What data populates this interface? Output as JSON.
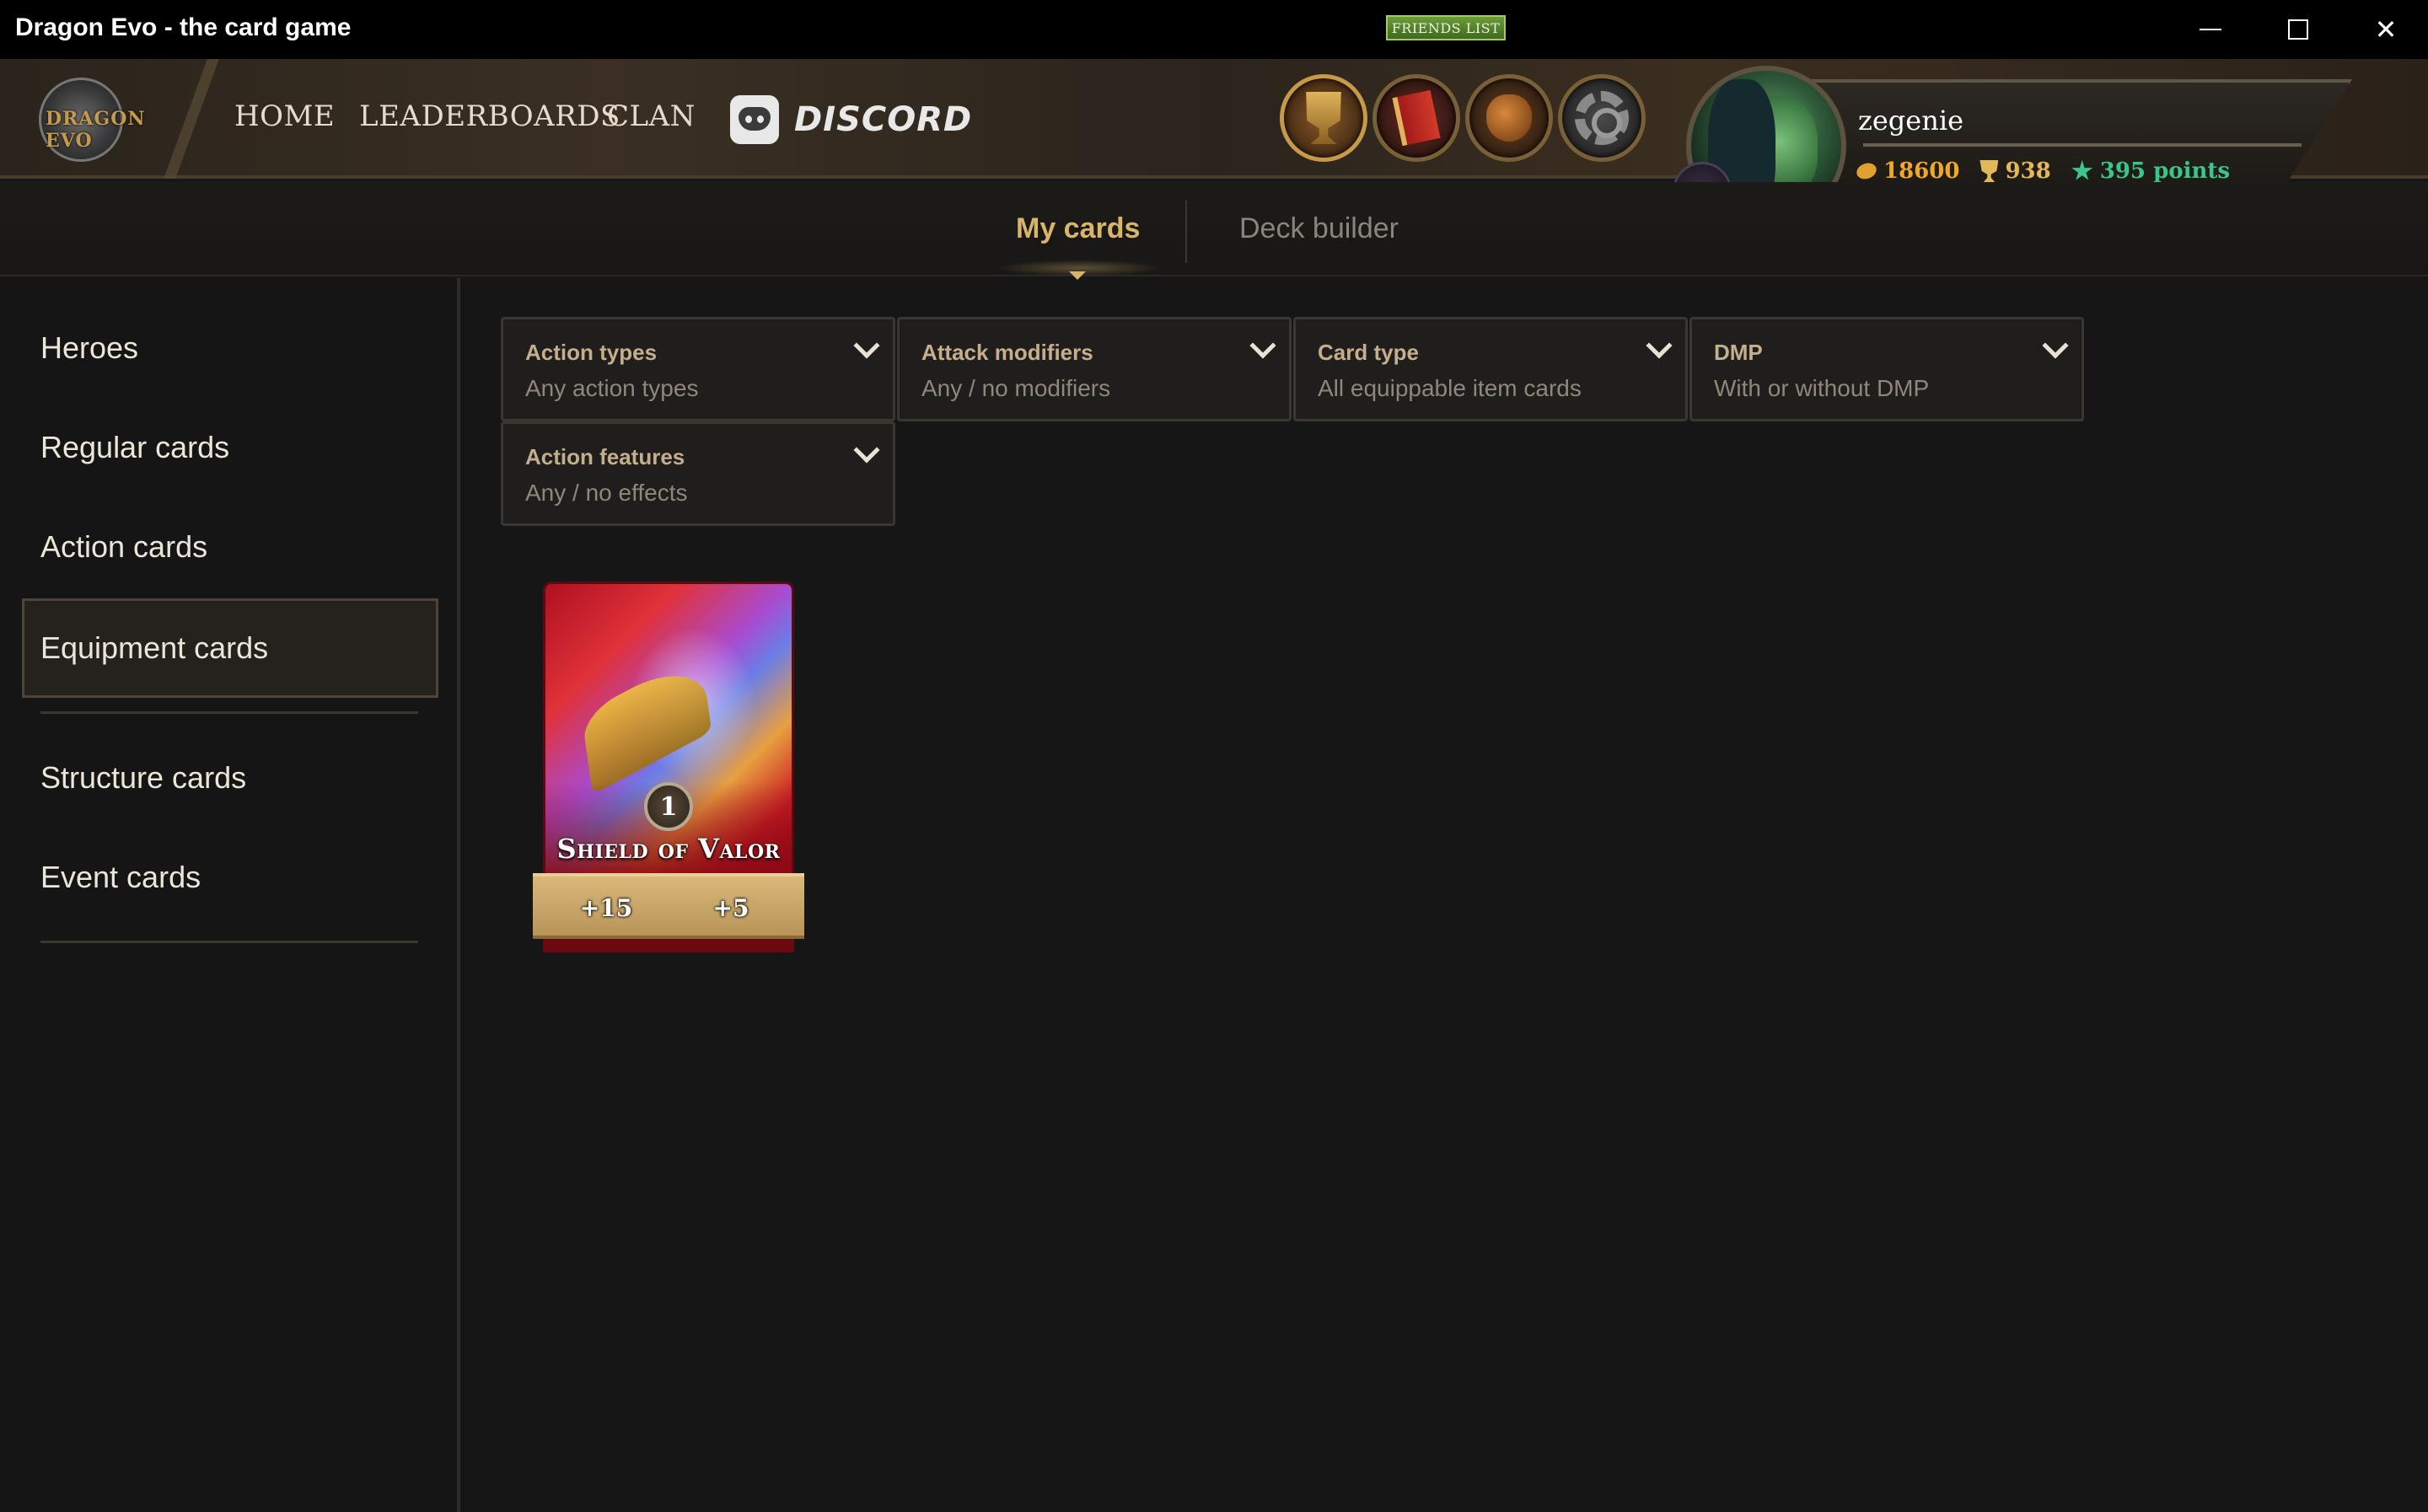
{
  "window": {
    "title": "Dragon Evo - the card game",
    "controls": {
      "minimize": "",
      "maximize": "",
      "close": "✕"
    }
  },
  "header": {
    "logo_text": "DRAGON EVO",
    "nav": [
      {
        "label": "HOME"
      },
      {
        "label": "LEADERBOARDS"
      },
      {
        "label": "CLAN"
      }
    ],
    "discord_label": "DISCORD",
    "icon_buttons": [
      "trophy-icon",
      "book-icon",
      "bag-icon",
      "gear-icon"
    ]
  },
  "profile": {
    "username": "zegenie",
    "gold": "18600",
    "trophies": "938",
    "points": "395 points",
    "friends_label": "FRIENDS LIST"
  },
  "tabs": {
    "my_cards": "My cards",
    "deck_builder": "Deck builder",
    "active": "my_cards"
  },
  "sidebar": {
    "items": [
      {
        "label": "Heroes"
      },
      {
        "label": "Regular cards"
      },
      {
        "label": "Action cards"
      },
      {
        "label": "Equipment cards",
        "selected": true
      },
      {
        "label": "Structure cards"
      },
      {
        "label": "Event cards"
      }
    ]
  },
  "filters": [
    {
      "label": "Action types",
      "value": "Any action types"
    },
    {
      "label": "Attack modifiers",
      "value": "Any / no modifiers"
    },
    {
      "label": "Card type",
      "value": "All equippable item cards"
    },
    {
      "label": "DMP",
      "value": "With or without DMP"
    },
    {
      "label": "Action features",
      "value": "Any / no effects"
    }
  ],
  "cards": [
    {
      "name": "Shield of Valor",
      "cost": "1",
      "stat_a": "+15",
      "stat_b": "+5"
    }
  ],
  "colors": {
    "accent_gold": "#d9b56a",
    "friends_green": "#6a9c3a",
    "points_green": "#3cc48a",
    "gold_text": "#f0a82a"
  }
}
